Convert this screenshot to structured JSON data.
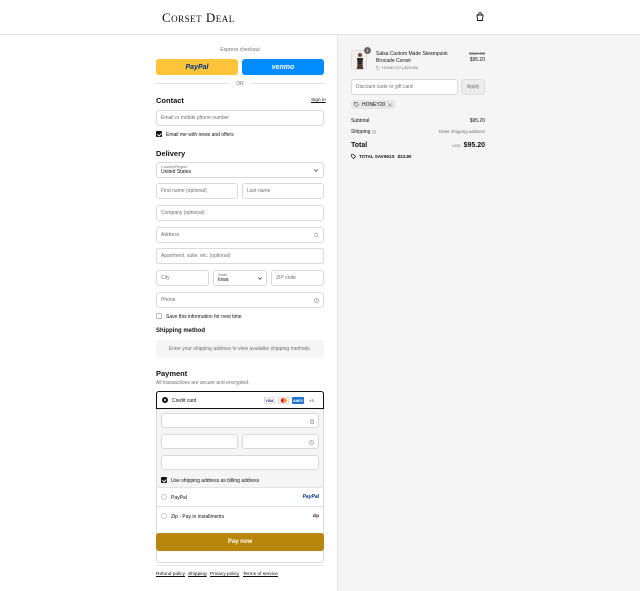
{
  "brand": {
    "logo": "Corset Deal"
  },
  "express": {
    "title": "Express checkout",
    "paypal": "PayPal",
    "venmo": "venmo",
    "or": "OR"
  },
  "contact": {
    "title": "Contact",
    "sign_in": "Sign in",
    "email_placeholder": "Email or mobile phone number",
    "newsletter": "Email me with news and offers"
  },
  "delivery": {
    "title": "Delivery",
    "country_label": "Country/Region",
    "country_value": "United States",
    "first_name": "First name (optional)",
    "last_name": "Last name",
    "company": "Company (optional)",
    "address": "Address",
    "apartment": "Apartment, suite, etc. (optional)",
    "city": "City",
    "state_label": "State",
    "state_value": "Iowa",
    "zip": "ZIP code",
    "phone": "Phone",
    "save_info": "Save this information for next time"
  },
  "shipping": {
    "title": "Shipping method",
    "notice": "Enter your shipping address to view available shipping methods."
  },
  "payment": {
    "title": "Payment",
    "subtitle": "All transactions are secure and encrypted.",
    "credit_card": "Credit card",
    "cards": [
      "VISA",
      "MC",
      "AMEX",
      "+3"
    ],
    "use_shipping": "Use shipping address as billing address",
    "paypal_option": "PayPal",
    "paypal_logo": "PayPal",
    "zip_option": "Zip - Pay in installments",
    "zip_logo": "zip",
    "pay_button": "Pay now"
  },
  "footer": {
    "links": [
      "Refund policy",
      "Shipping",
      "Privacy policy",
      "Terms of service"
    ]
  },
  "summary": {
    "item_name": "Salsa Custom Made Steampunk Brocade Corset",
    "item_qty": "1",
    "item_discount": "HONEY20 (-$23.80)",
    "item_original_price": "$119.00",
    "item_price": "$95.20",
    "discount_placeholder": "Discount code or gift card",
    "apply": "Apply",
    "code_tag": "HONEY20",
    "subtotal_label": "Subtotal",
    "subtotal_value": "$95.20",
    "shipping_label": "Shipping",
    "shipping_value": "Enter shipping address",
    "total_label": "Total",
    "currency": "USD",
    "total_value": "$95.20",
    "savings_label": "TOTAL SAVINGS",
    "savings_value": "$23.80"
  },
  "colors": {
    "paypal_yellow": "#ffc439",
    "venmo_blue": "#008cff",
    "pay_button": "#b8860b",
    "amex_blue": "#1f72cd"
  }
}
